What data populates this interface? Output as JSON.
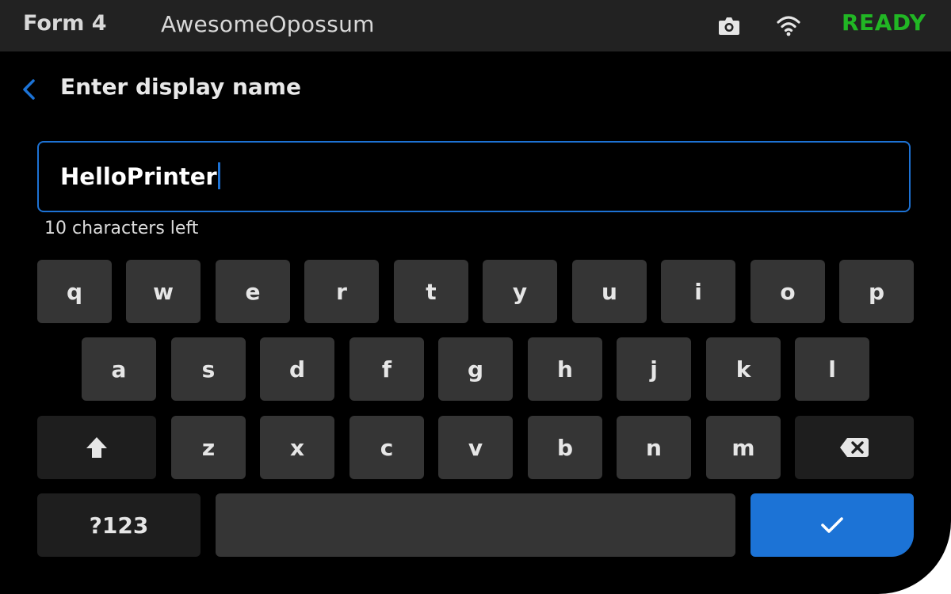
{
  "status_bar": {
    "model": "Form 4",
    "printer_name": "AwesomeOpossum",
    "status": "READY",
    "status_color": "#21b624",
    "icons": [
      "camera-icon",
      "wifi-icon"
    ]
  },
  "header": {
    "back_icon": "chevron-left-icon",
    "title": "Enter display name"
  },
  "input": {
    "value": "HelloPrinter",
    "helper": "10 characters left"
  },
  "keyboard": {
    "row1": [
      "q",
      "w",
      "e",
      "r",
      "t",
      "y",
      "u",
      "i",
      "o",
      "p"
    ],
    "row2": [
      "a",
      "s",
      "d",
      "f",
      "g",
      "h",
      "j",
      "k",
      "l"
    ],
    "row3": [
      "z",
      "x",
      "c",
      "v",
      "b",
      "n",
      "m"
    ],
    "shift_icon": "shift-arrow-icon",
    "backspace_icon": "backspace-icon",
    "symbols_label": "?123",
    "space_label": "",
    "enter_icon": "checkmark-icon"
  },
  "colors": {
    "accent": "#1c73d6",
    "background": "#000000",
    "topbar": "#222222",
    "key": "#353535"
  }
}
